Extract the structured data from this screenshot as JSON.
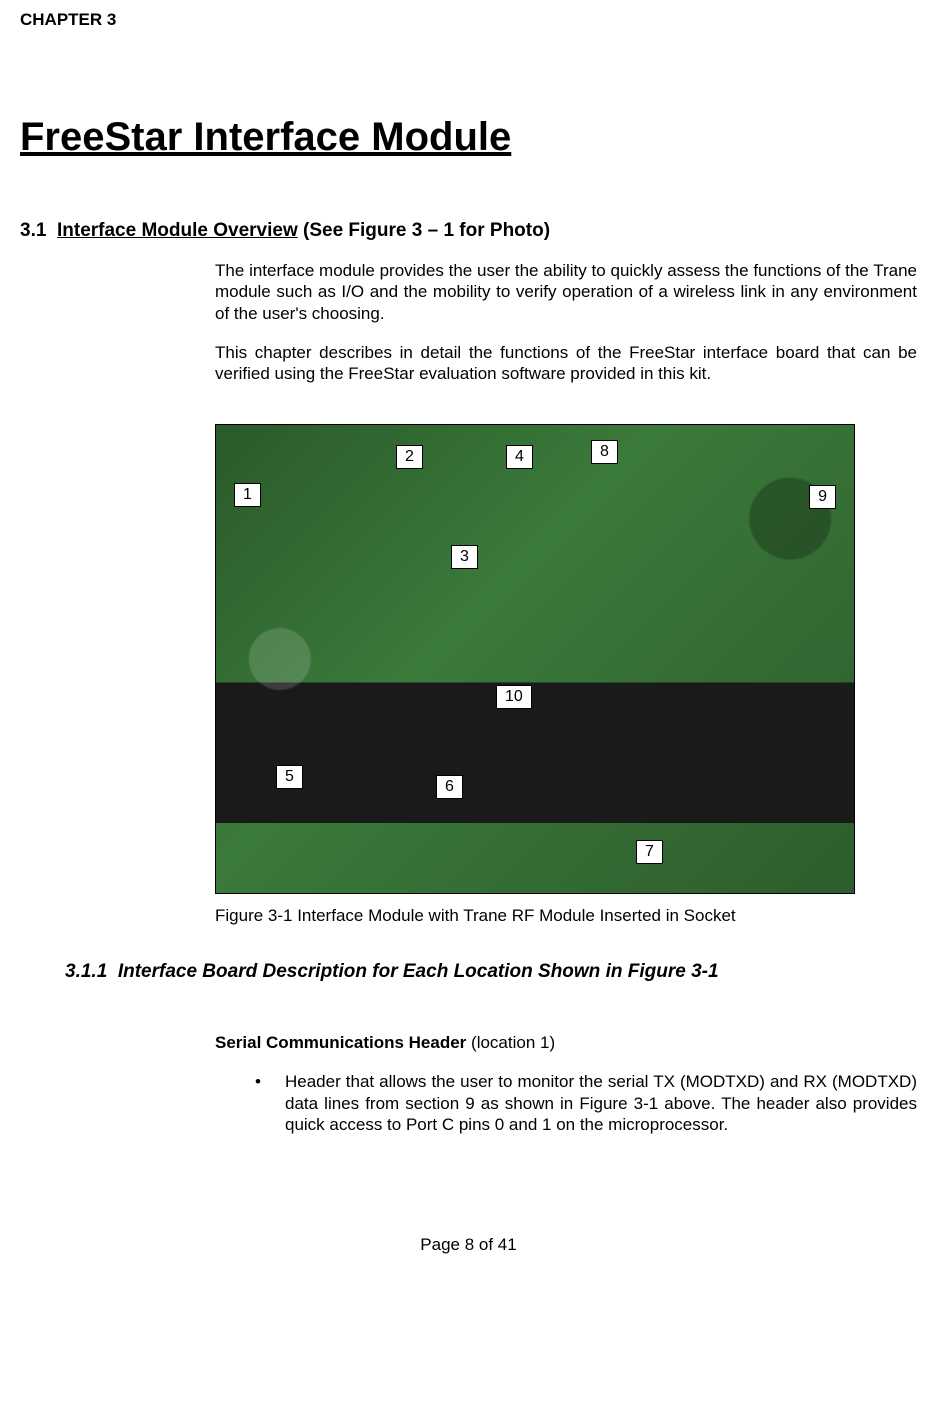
{
  "chapter": {
    "label": "CHAPTER 3",
    "title": "FreeStar Interface Module"
  },
  "section": {
    "number": "3.1",
    "title_underlined": "Interface Module Overview",
    "title_plain": " (See Figure 3 – 1 for Photo)",
    "para1": "The interface module provides the user the ability to quickly assess the functions of the Trane module such as I/O and the mobility to verify operation of a wireless link in any environment of the user's choosing.",
    "para2": "This chapter describes in detail the functions of the FreeStar interface board that can be verified using the FreeStar evaluation software provided in this kit."
  },
  "callouts": {
    "c1": "1",
    "c2": "2",
    "c3": "3",
    "c4": "4",
    "c5": "5",
    "c6": "6",
    "c7": "7",
    "c8": "8",
    "c9": "9",
    "c10": "10"
  },
  "figure_caption": "Figure 3-1 Interface Module with Trane RF Module Inserted in Socket",
  "subsection": {
    "number": "3.1.1",
    "title": "Interface Board Description for Each Location Shown in Figure 3-1"
  },
  "item1": {
    "heading_bold": "Serial Communications Header",
    "heading_plain": " (location 1)",
    "bullet_text": "Header that allows the user to monitor the serial TX (MODTXD) and RX (MODTXD) data lines from section 9 as shown in Figure 3-1 above.  The header also provides quick access to Port C pins 0 and 1 on the microprocessor."
  },
  "footer": "Page 8 of 41"
}
